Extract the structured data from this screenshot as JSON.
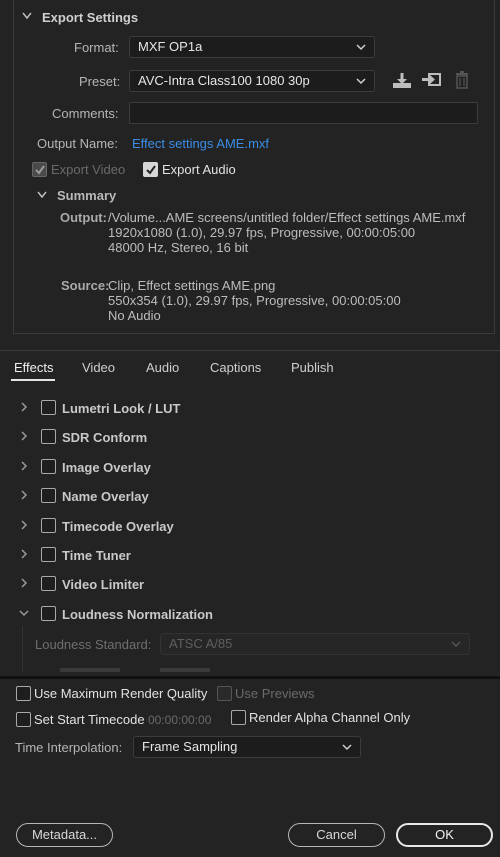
{
  "export_settings": {
    "header": "Export Settings",
    "format_label": "Format:",
    "format_value": "MXF OP1a",
    "preset_label": "Preset:",
    "preset_value": "AVC-Intra Class100 1080 30p",
    "comments_label": "Comments:",
    "comments_value": "",
    "output_name_label": "Output Name:",
    "output_name_value": "Effect settings AME.mxf",
    "export_video_label": "Export Video",
    "export_audio_label": "Export Audio",
    "export_video_checked": true,
    "export_audio_checked": true
  },
  "summary": {
    "header": "Summary",
    "output_label": "Output:",
    "output_lines": [
      "/Volume...AME screens/untitled folder/Effect settings AME.mxf",
      "1920x1080 (1.0), 29.97 fps, Progressive, 00:00:05:00",
      "48000 Hz, Stereo, 16 bit"
    ],
    "source_label": "Source:",
    "source_lines": [
      "Clip, Effect settings AME.png",
      "550x354 (1.0), 29.97 fps, Progressive, 00:00:05:00",
      "No Audio"
    ]
  },
  "tabs": [
    {
      "label": "Effects"
    },
    {
      "label": "Video"
    },
    {
      "label": "Audio"
    },
    {
      "label": "Captions"
    },
    {
      "label": "Publish"
    }
  ],
  "effects": [
    {
      "label": "Lumetri Look / LUT"
    },
    {
      "label": "SDR Conform"
    },
    {
      "label": "Image Overlay"
    },
    {
      "label": "Name Overlay"
    },
    {
      "label": "Timecode Overlay"
    },
    {
      "label": "Time Tuner"
    },
    {
      "label": "Video Limiter"
    },
    {
      "label": "Loudness Normalization"
    }
  ],
  "loudness": {
    "standard_label": "Loudness Standard:",
    "standard_value": "ATSC A/85"
  },
  "render": {
    "max_quality_label": "Use Maximum Render Quality",
    "use_previews_label": "Use Previews",
    "start_timecode_label": "Set Start Timecode",
    "start_timecode_value": "00:00:00:00",
    "alpha_only_label": "Render Alpha Channel Only",
    "time_interp_label": "Time Interpolation:",
    "time_interp_value": "Frame Sampling"
  },
  "buttons": {
    "metadata": "Metadata...",
    "cancel": "Cancel",
    "ok": "OK"
  }
}
